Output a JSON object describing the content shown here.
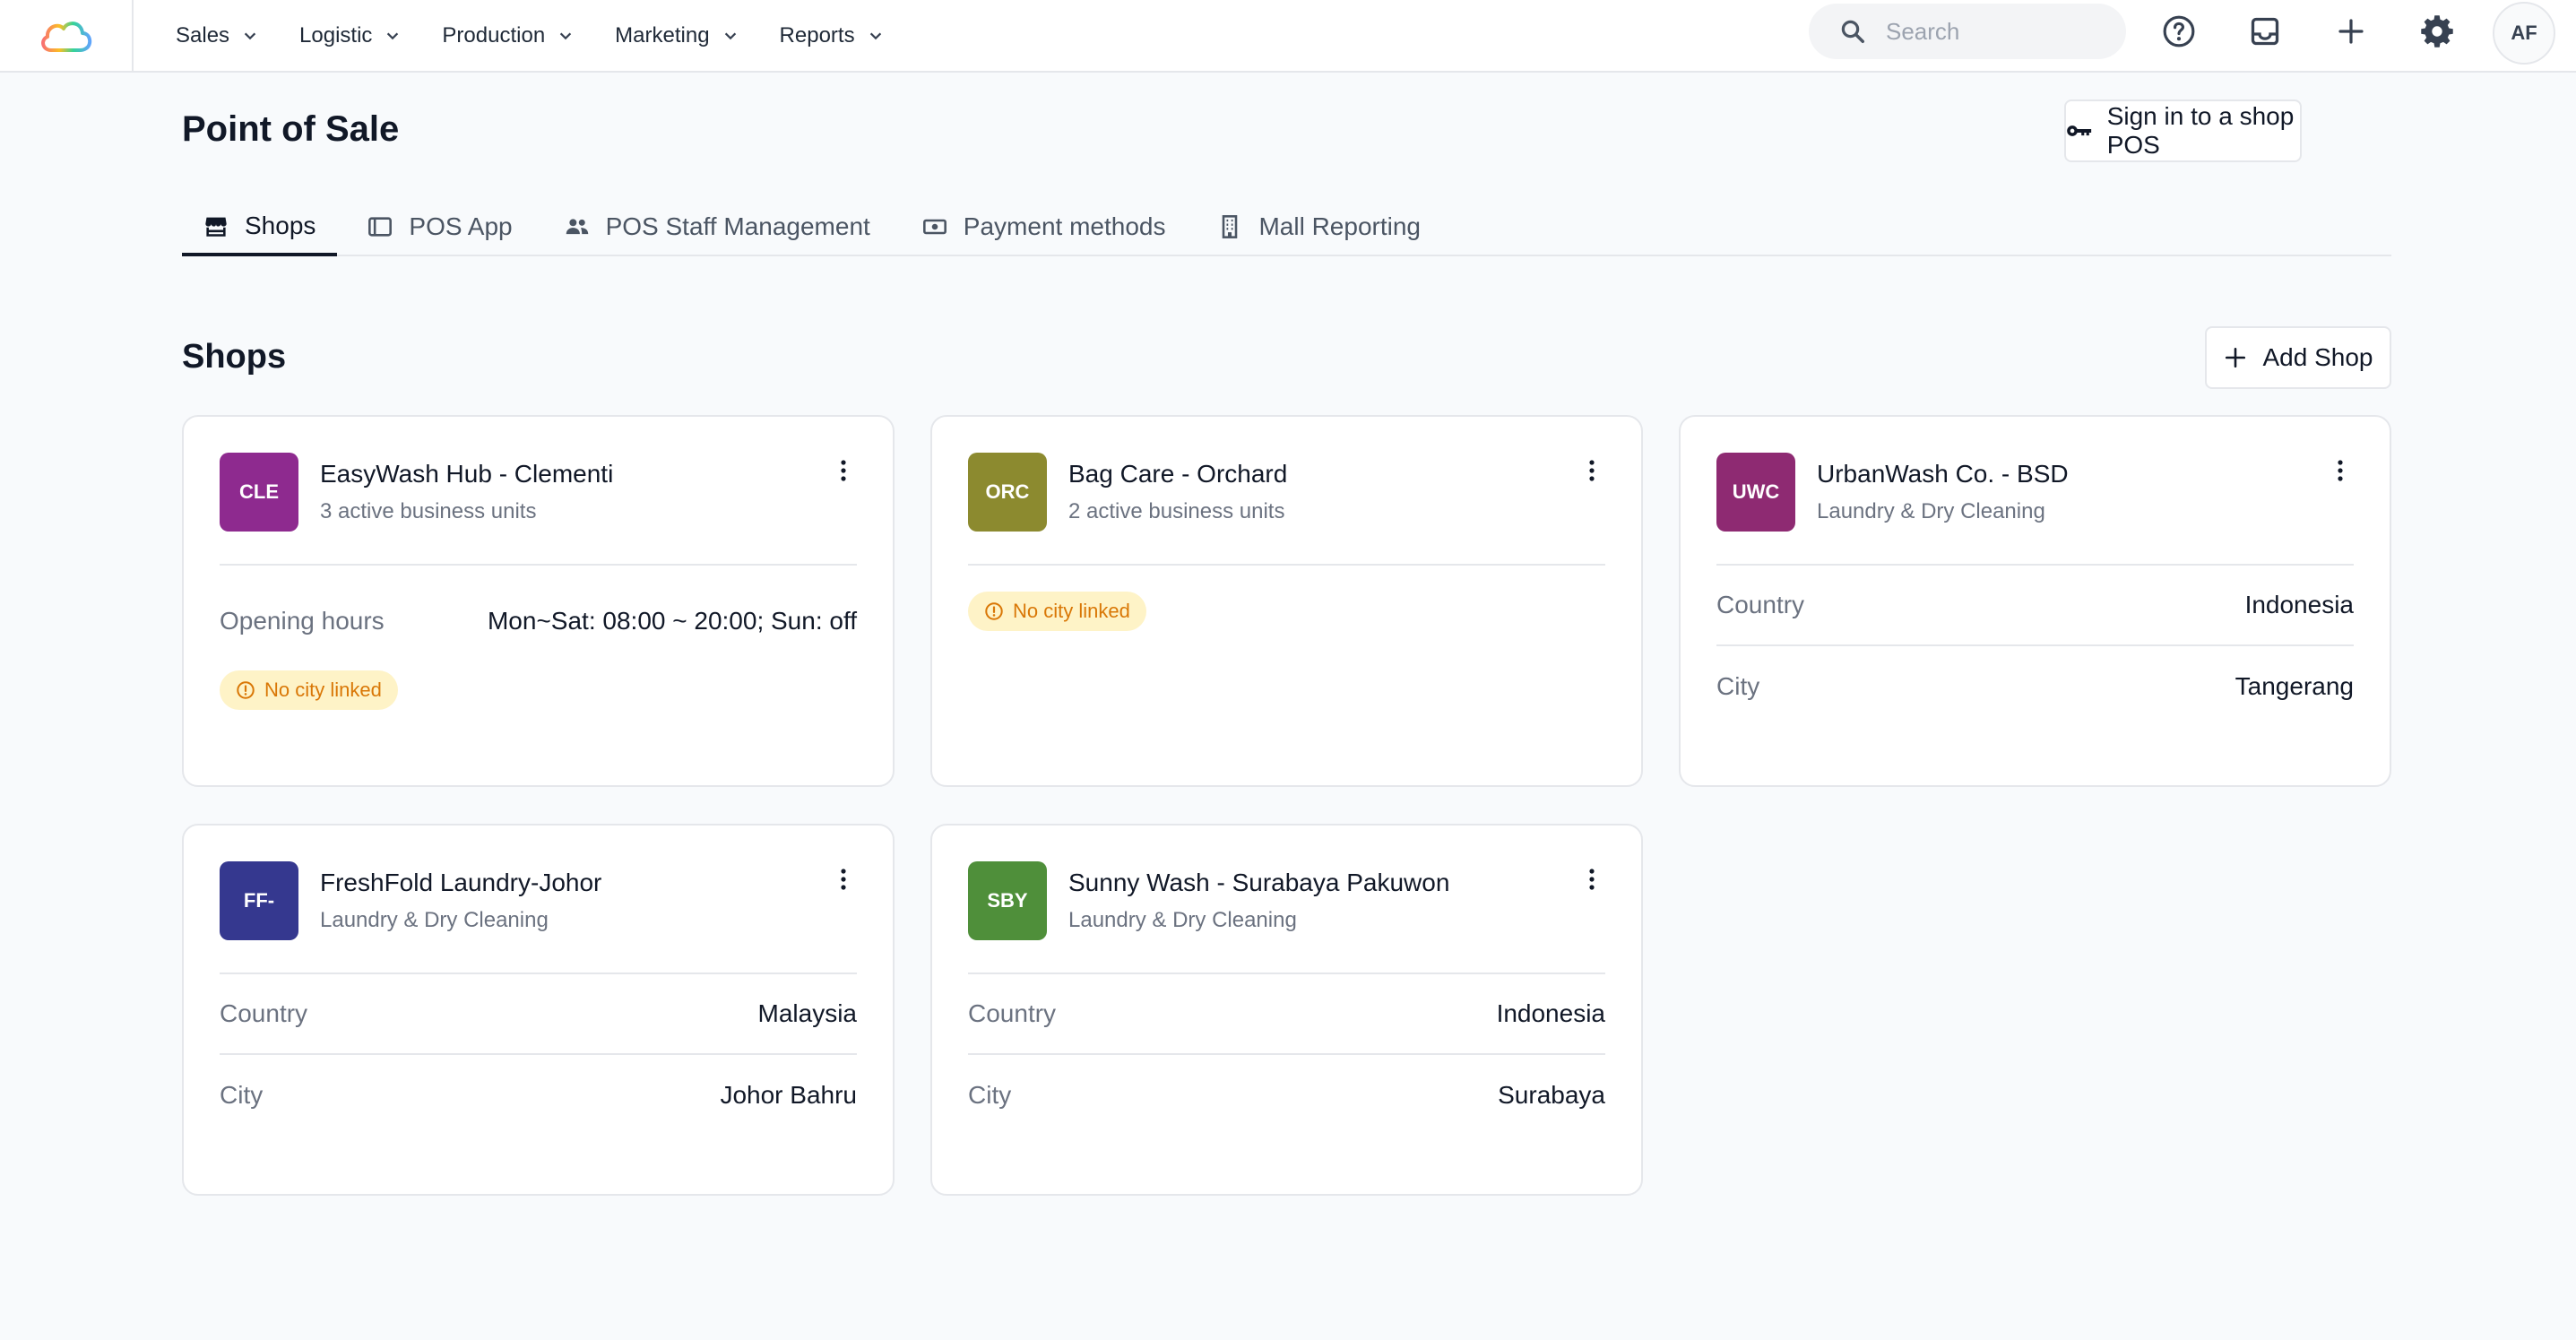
{
  "nav": {
    "menu": [
      {
        "label": "Sales"
      },
      {
        "label": "Logistic"
      },
      {
        "label": "Production"
      },
      {
        "label": "Marketing"
      },
      {
        "label": "Reports"
      }
    ],
    "search_placeholder": "Search",
    "avatar_initials": "AF"
  },
  "header": {
    "title": "Point of Sale",
    "signin_label": "Sign in to a shop POS"
  },
  "tabs": [
    {
      "label": "Shops",
      "icon": "store-icon",
      "active": true
    },
    {
      "label": "POS App",
      "icon": "tablet-icon",
      "active": false
    },
    {
      "label": "POS Staff Management",
      "icon": "people-icon",
      "active": false
    },
    {
      "label": "Payment methods",
      "icon": "cash-icon",
      "active": false
    },
    {
      "label": "Mall Reporting",
      "icon": "building-icon",
      "active": false
    }
  ],
  "shops_section": {
    "title": "Shops",
    "add_label": "Add Shop"
  },
  "shops": [
    {
      "initials": "CLE",
      "color": "#8e2a8f",
      "name": "EasyWash Hub - Clementi",
      "subtitle": "3 active business units",
      "rows": [
        {
          "key": "Opening hours",
          "value": "Mon~Sat: 08:00 ~ 20:00; Sun: off"
        }
      ],
      "badge": "No city linked"
    },
    {
      "initials": "ORC",
      "color": "#8c8a2f",
      "name": "Bag Care - Orchard",
      "subtitle": "2 active business units",
      "rows": [],
      "badge": "No city linked"
    },
    {
      "initials": "UWC",
      "color": "#8e2a72",
      "name": "UrbanWash Co. - BSD",
      "subtitle": "Laundry & Dry Cleaning",
      "rows": [
        {
          "key": "Country",
          "value": "Indonesia"
        },
        {
          "key": "City",
          "value": "Tangerang"
        }
      ]
    },
    {
      "initials": "FF-",
      "color": "#35388f",
      "name": "FreshFold Laundry-Johor",
      "subtitle": "Laundry & Dry Cleaning",
      "rows": [
        {
          "key": "Country",
          "value": "Malaysia"
        },
        {
          "key": "City",
          "value": "Johor Bahru"
        }
      ]
    },
    {
      "initials": "SBY",
      "color": "#4f8f3a",
      "name": "Sunny Wash - Surabaya Pakuwon",
      "subtitle": "Laundry & Dry Cleaning",
      "rows": [
        {
          "key": "Country",
          "value": "Indonesia"
        },
        {
          "key": "City",
          "value": "Surabaya"
        }
      ]
    }
  ],
  "colors": {
    "badge_bg": "#fef3c7",
    "badge_text": "#d97706",
    "tab_active": "#111827"
  }
}
